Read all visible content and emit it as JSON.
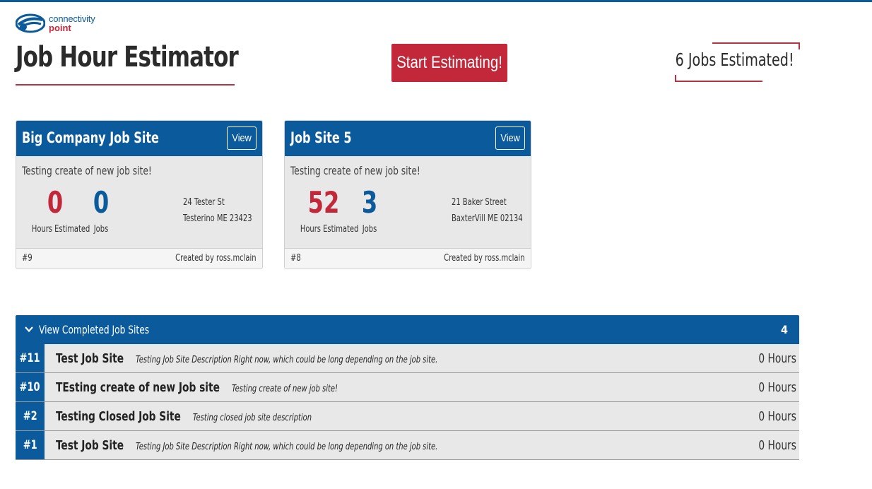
{
  "logo": {
    "line1": "connectivity",
    "line2": "point",
    "icon": "connectivity-point-logo-icon"
  },
  "page_title": "Job Hour Estimator",
  "start_button": "Start Estimating!",
  "jobs_estimated": "6 Jobs Estimated!",
  "colors": {
    "primary": "#0a5a9c",
    "accent": "#c3283a",
    "card_bg": "#e8e8e8"
  },
  "cards": [
    {
      "title": "Big Company Job Site",
      "view_label": "View",
      "description": "Testing create of new job site!",
      "hours": "0",
      "hours_label": "Hours Estimated",
      "jobs": "0",
      "jobs_label": "Jobs",
      "address_line1": "24 Tester St",
      "address_line2": "Testerino ME 23423",
      "id": "#9",
      "creator": "Created by ross.mclain"
    },
    {
      "title": "Job Site 5",
      "view_label": "View",
      "description": "Testing create of new job site!",
      "hours": "52",
      "hours_label": "Hours Estimated",
      "jobs": "3",
      "jobs_label": "Jobs",
      "address_line1": "21 Baker Street",
      "address_line2": "BaxterVill ME 02134",
      "id": "#8",
      "creator": "Created by ross.mclain"
    }
  ],
  "completed": {
    "title": "View Completed Job Sites",
    "count": "4",
    "icon": "chevron-down-icon",
    "rows": [
      {
        "num": "#11",
        "name": "Test Job Site",
        "desc": "Testing Job Site Description Right now, which could be long depending on the job site.",
        "hours": "0 Hours"
      },
      {
        "num": "#10",
        "name": "TEsting create of new Job site",
        "desc": "Testing create of new job site!",
        "hours": "0 Hours"
      },
      {
        "num": "#2",
        "name": "Testing Closed Job Site",
        "desc": "Testing closed job site description",
        "hours": "0 Hours"
      },
      {
        "num": "#1",
        "name": "Test Job Site",
        "desc": "Testing Job Site Description Right now, which could be long depending on the job site.",
        "hours": "0 Hours"
      }
    ]
  }
}
